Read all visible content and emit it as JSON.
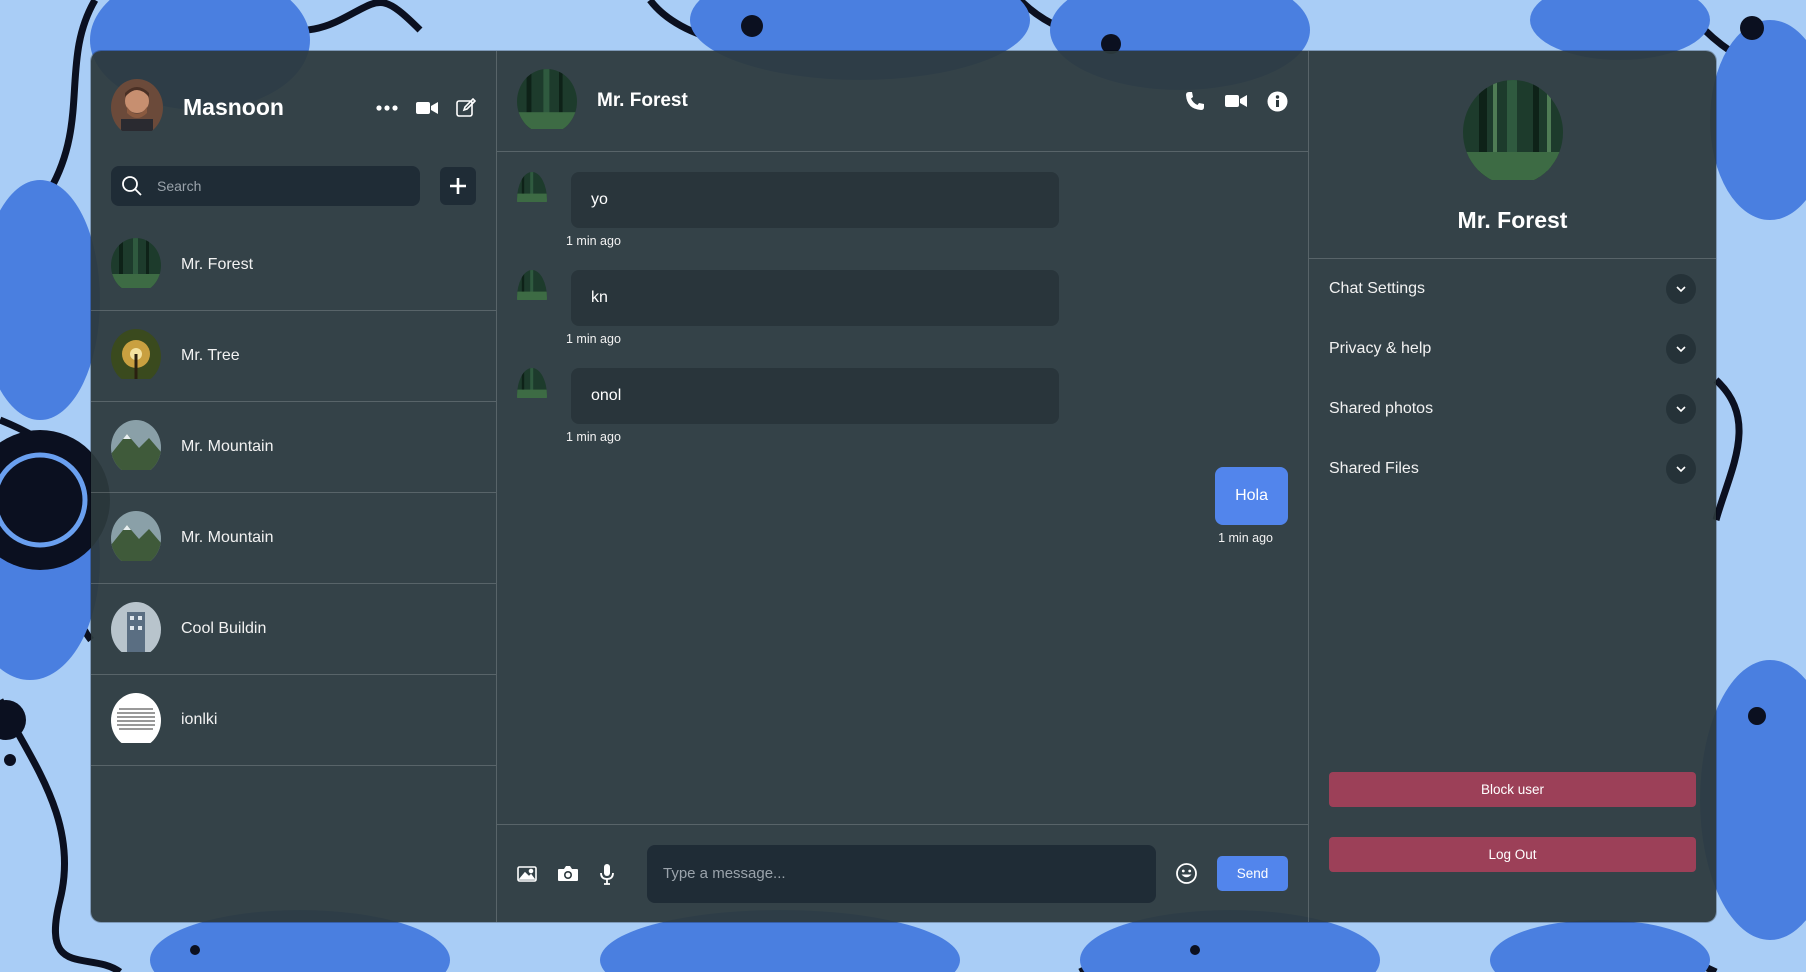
{
  "colors": {
    "accent": "#5285ec",
    "danger": "#9c4058",
    "panel": "#2d393d",
    "background": "#a9cdf6"
  },
  "sidebar": {
    "user_name": "Masnoon",
    "header_icons": [
      "more-horizontal-icon",
      "video-camera-icon",
      "edit-icon"
    ],
    "search": {
      "placeholder": "Search",
      "value": ""
    },
    "add_icon": "plus-icon",
    "chats": [
      {
        "name": "Mr. Forest",
        "avatar": "forest"
      },
      {
        "name": "Mr. Tree",
        "avatar": "tree"
      },
      {
        "name": "Mr. Mountain",
        "avatar": "mountain"
      },
      {
        "name": "Mr. Mountain",
        "avatar": "mountain"
      },
      {
        "name": "Cool Buildin",
        "avatar": "building"
      },
      {
        "name": "ionlki",
        "avatar": "text"
      }
    ]
  },
  "chat": {
    "title": "Mr. Forest",
    "header_icons": [
      "phone-icon",
      "video-camera-icon",
      "info-icon"
    ],
    "messages": [
      {
        "text": "yo",
        "time": "1 min ago",
        "own": false
      },
      {
        "text": "kn",
        "time": "1 min ago",
        "own": false
      },
      {
        "text": "onol",
        "time": "1 min ago",
        "own": false
      },
      {
        "text": "Hola",
        "time": "1 min ago",
        "own": true
      }
    ],
    "composer": {
      "tools": [
        "image-icon",
        "camera-icon",
        "microphone-icon"
      ],
      "placeholder": "Type a message...",
      "value": "",
      "emoji_icon": "emoji-icon",
      "send_label": "Send"
    }
  },
  "details": {
    "name": "Mr. Forest",
    "options": [
      {
        "label": "Chat Settings"
      },
      {
        "label": "Privacy & help"
      },
      {
        "label": "Shared photos"
      },
      {
        "label": "Shared Files"
      }
    ],
    "block_label": "Block user",
    "logout_label": "Log Out"
  }
}
